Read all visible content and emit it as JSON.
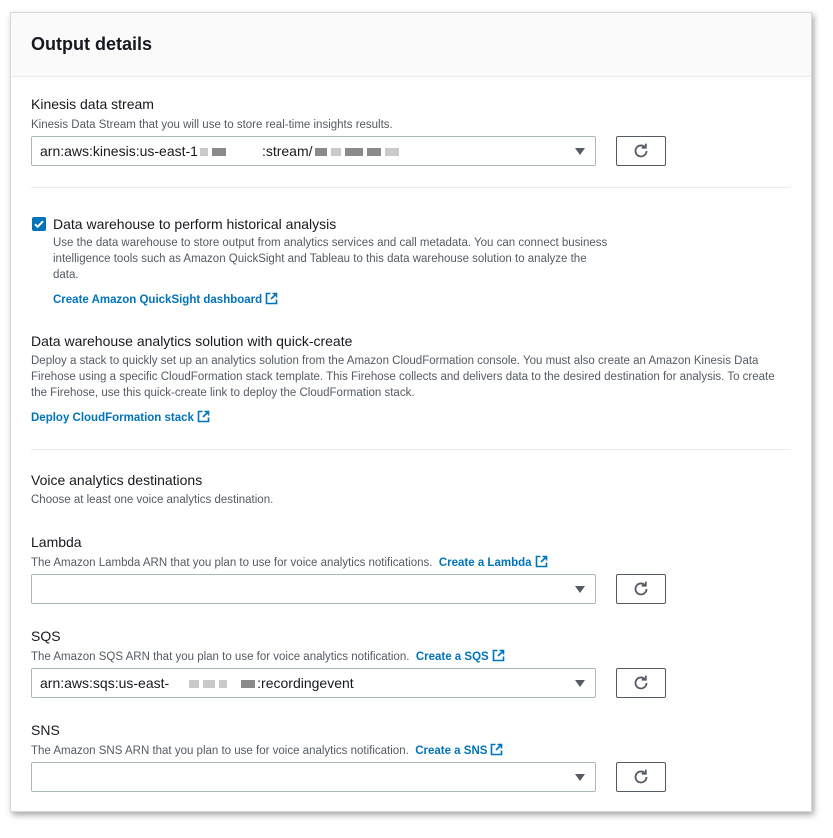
{
  "panel": {
    "title": "Output details"
  },
  "kinesis": {
    "label": "Kinesis data stream",
    "description": "Kinesis Data Stream that you will use to store real-time insights results.",
    "value_prefix": "arn:aws:kinesis:us-east-1",
    "value_middle": ":stream/"
  },
  "warehouse": {
    "checkbox_label": "Data warehouse to perform historical analysis",
    "checked": true,
    "description": "Use the data warehouse to store output from analytics services and call metadata. You can connect business intelligence tools such as Amazon QuickSight and Tableau to this data warehouse solution to analyze the data.",
    "link": "Create Amazon QuickSight dashboard"
  },
  "quick_create": {
    "label": "Data warehouse analytics solution with quick-create",
    "description": "Deploy a stack to quickly set up an analytics solution from the Amazon CloudFormation console. You must also create an Amazon Kinesis Data Firehose using a specific CloudFormation stack template. This Firehose collects and delivers data to the desired destination for analysis. To create the Firehose, use this quick-create link to deploy the CloudFormation stack.",
    "link": "Deploy CloudFormation stack"
  },
  "voice": {
    "label": "Voice analytics destinations",
    "description": "Choose at least one voice analytics destination."
  },
  "lambda": {
    "label": "Lambda",
    "description": "The Amazon Lambda ARN that you plan to use for voice analytics notifications.",
    "link": "Create a Lambda",
    "value": ""
  },
  "sqs": {
    "label": "SQS",
    "description": "The Amazon SQS ARN that you plan to use for voice analytics notification.",
    "link": "Create a SQS",
    "value_prefix": "arn:aws:sqs:us-east-",
    "value_suffix": ":recordingevent"
  },
  "sns": {
    "label": "SNS",
    "description": "The Amazon SNS ARN that you plan to use for voice analytics notification.",
    "link": "Create a SNS",
    "value": ""
  },
  "colors": {
    "link": "#0073bb",
    "checkbox": "#0073bb"
  },
  "icons": {
    "refresh": "refresh-icon",
    "external": "external-link-icon",
    "caret": "caret-down-icon"
  }
}
